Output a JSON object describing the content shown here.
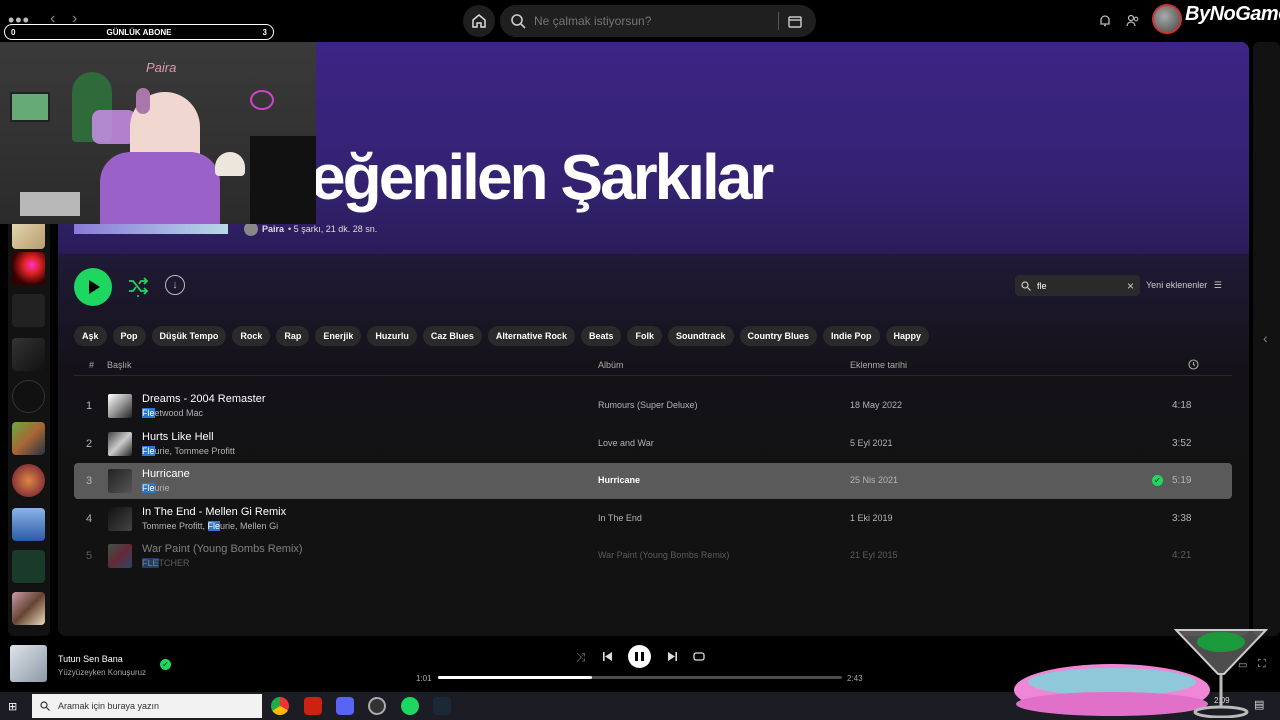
{
  "topbar": {
    "search_placeholder": "Ne çalmak istiyorsun?",
    "brand": "ByNoGame"
  },
  "subscriber_bar": {
    "left": "0",
    "label": "GÜNLÜK ABONE",
    "right": "3"
  },
  "playlist": {
    "title": "eğenilen Şarkılar",
    "owner": "Paira",
    "meta": "• 5 şarkı, 21 dk. 28 sn."
  },
  "filter": {
    "value": "fle",
    "sort_label": "Yeni eklenenler"
  },
  "chips": [
    "Aşk",
    "Pop",
    "Düşük Tempo",
    "Rock",
    "Rap",
    "Enerjik",
    "Huzurlu",
    "Caz Blues",
    "Alternative Rock",
    "Beats",
    "Folk",
    "Soundtrack",
    "Country Blues",
    "Indie Pop",
    "Happy"
  ],
  "table": {
    "headers": {
      "num": "#",
      "title": "Başlık",
      "album": "Albüm",
      "date": "Eklenme tarihi"
    },
    "rows": [
      {
        "num": "1",
        "title": "Dreams - 2004 Remaster",
        "artist_hl": "Fle",
        "artist_rest": "etwood Mac",
        "artist_pre": "",
        "album": "Rumours (Super Deluxe)",
        "date": "18 May 2022",
        "duration": "4:18"
      },
      {
        "num": "2",
        "title": "Hurts Like Hell",
        "artist_hl": "Fle",
        "artist_rest": "urie, Tommee Profitt",
        "artist_pre": "",
        "album": "Love and War",
        "date": "5 Eyl 2021",
        "duration": "3:52"
      },
      {
        "num": "3",
        "title": "Hurricane",
        "artist_hl": "Fle",
        "artist_rest": "urie",
        "artist_pre": "",
        "album": "Hurricane",
        "date": "25 Nis 2021",
        "duration": "5:19"
      },
      {
        "num": "4",
        "title": "In The End - Mellen Gi Remix",
        "artist_pre": "Tommee Profitt, ",
        "artist_hl": "Fle",
        "artist_rest": "urie, Mellen Gi",
        "album": "In The End",
        "date": "1 Eki 2019",
        "duration": "3:38"
      },
      {
        "num": "5",
        "title": "War Paint (Young Bombs Remix)",
        "artist_hl": "FLE",
        "artist_rest": "TCHER",
        "artist_pre": "",
        "album": "War Paint (Young Bombs Remix)",
        "date": "21 Eyl 2015",
        "duration": "4:21"
      }
    ]
  },
  "player": {
    "track": "Tutun Sen Bana",
    "artist": "Yüzyüzeyken Konuşuruz",
    "elapsed": "1:01",
    "total": "2:43",
    "progress": 0.38
  },
  "taskbar": {
    "search_text": "Aramak için buraya yazın",
    "clock": "2:09"
  }
}
